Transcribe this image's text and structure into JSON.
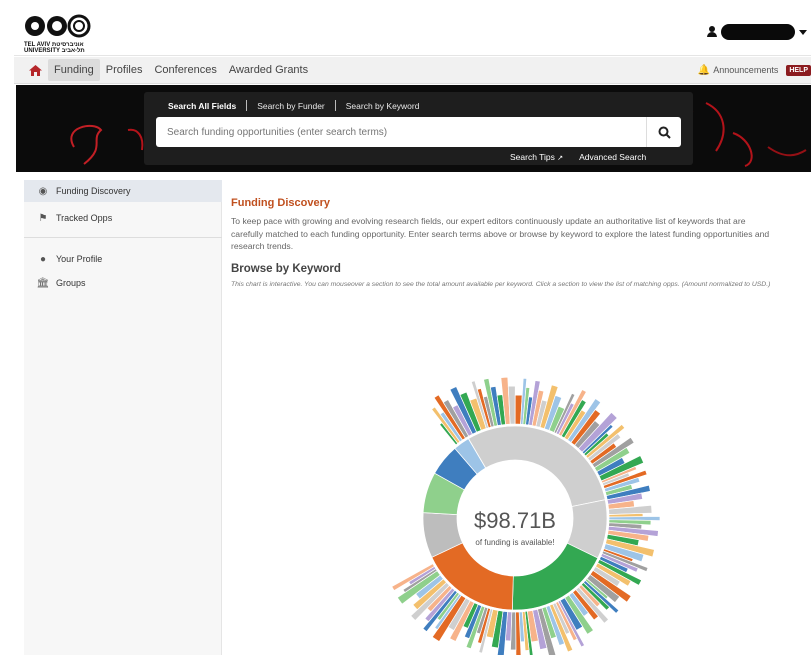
{
  "header": {
    "logo_text": "TEL AVIV אוניברסיטת\nUNIVERSITY תל-אביב",
    "user_name": ""
  },
  "nav": {
    "items": [
      {
        "label": "Funding",
        "active": true
      },
      {
        "label": "Profiles"
      },
      {
        "label": "Conferences"
      },
      {
        "label": "Awarded Grants"
      }
    ],
    "announcements": "Announcements",
    "help": "HELP"
  },
  "search": {
    "tabs": [
      "Search All Fields",
      "Search by Funder",
      "Search by Keyword"
    ],
    "placeholder": "Search funding opportunities (enter search terms)",
    "value": "",
    "tips": "Search Tips",
    "advanced": "Advanced Search"
  },
  "sidebar": {
    "items": [
      {
        "label": "Funding Discovery",
        "icon": "discovery-icon",
        "active": true
      },
      {
        "label": "Tracked Opps",
        "icon": "flag-icon"
      },
      {
        "label": "Your Profile",
        "icon": "user-icon"
      },
      {
        "label": "Groups",
        "icon": "institution-icon"
      }
    ]
  },
  "main": {
    "title": "Funding Discovery",
    "description": "To keep pace with growing and evolving research fields, our expert editors continuously update an authoritative list of keywords that are carefully matched to each funding opportunity. Enter search terms above or browse by keyword to explore the latest funding opportunities and research trends.",
    "browse_title": "Browse by Keyword",
    "browse_description": "This chart is interactive. You can mouseover a section to see the total amount available per keyword. Click a section to view the list of matching opps. (Amount normalized to USD.)",
    "total_amount": "$98.71B",
    "total_sub": "of funding is available!"
  },
  "colors": {
    "accent": "#c0501f",
    "brand": "#b5262a",
    "banner": "#0b0b0b",
    "chart_green": "#33a852",
    "chart_orange": "#e36a24",
    "chart_blue": "#3f7ebf",
    "chart_gray": "#cfcfcf"
  }
}
